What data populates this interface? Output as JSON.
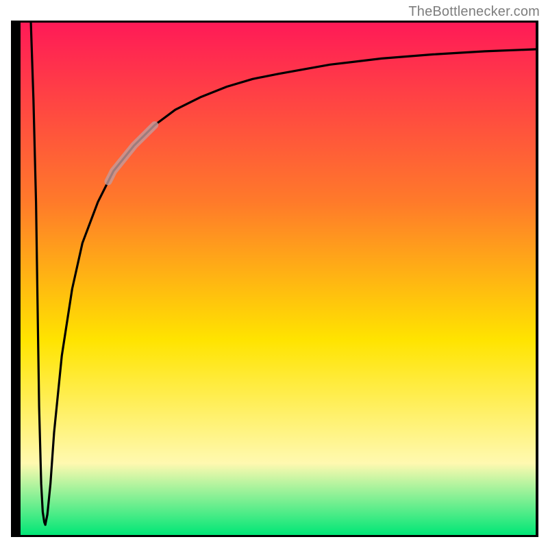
{
  "attribution": "TheBottlenecker.com",
  "chart_data": {
    "type": "line",
    "title": "",
    "xlabel": "",
    "ylabel": "",
    "xlim": [
      0,
      100
    ],
    "ylim": [
      0,
      100
    ],
    "grid": false,
    "legend": false,
    "notes": "Axes have no tick labels; values below are estimated from gridless geometry on a 0–100 scale derived from the frame.",
    "background_gradient": {
      "top": "#ff1a57",
      "upper_mid": "#ff7a2a",
      "mid": "#ffe400",
      "lower_mid": "#fff9b0",
      "bottom": "#00e676"
    },
    "highlight_segment": {
      "x_range": [
        17,
        26
      ],
      "y_range": [
        68,
        80
      ],
      "color": "#c49b9b",
      "opacity": 0.8
    },
    "series": [
      {
        "name": "left-descent",
        "x": [
          2.0,
          2.5,
          3.0,
          3.3,
          3.6,
          4.0,
          4.3,
          4.6,
          4.8
        ],
        "values": [
          100,
          85,
          65,
          45,
          25,
          10,
          4.5,
          2.5,
          2.0
        ]
      },
      {
        "name": "main-curve",
        "x": [
          4.8,
          5.2,
          5.8,
          6.5,
          8,
          10,
          12,
          15,
          18,
          22,
          26,
          30,
          35,
          40,
          45,
          50,
          60,
          70,
          80,
          90,
          100
        ],
        "values": [
          2.0,
          4,
          10,
          20,
          35,
          48,
          57,
          65,
          71,
          76,
          80,
          83,
          85.5,
          87.5,
          89,
          90,
          91.8,
          93,
          93.8,
          94.4,
          94.8
        ]
      }
    ]
  },
  "colors": {
    "frame": "#000000",
    "curve": "#000000",
    "highlight": "#c49b9b"
  }
}
